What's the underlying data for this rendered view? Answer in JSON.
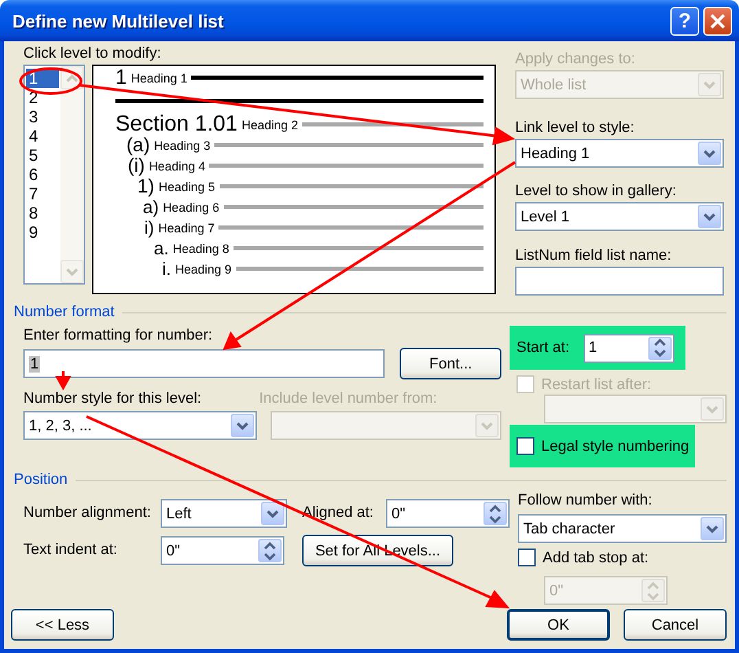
{
  "window": {
    "title": "Define new Multilevel list",
    "help_button": "?"
  },
  "level_list": {
    "label": "Click level to modify:",
    "items": [
      {
        "label": "1",
        "selected": true
      },
      {
        "label": "2",
        "selected": false
      },
      {
        "label": "3",
        "selected": false
      },
      {
        "label": "4",
        "selected": false
      },
      {
        "label": "5",
        "selected": false
      },
      {
        "label": "6",
        "selected": false
      },
      {
        "label": "7",
        "selected": false
      },
      {
        "label": "8",
        "selected": false
      },
      {
        "label": "9",
        "selected": false
      }
    ]
  },
  "preview": {
    "levels": [
      {
        "number": "1",
        "heading": "Heading 1",
        "selected": true
      },
      {
        "number": "Section 1.01",
        "heading": "Heading 2",
        "selected": false
      },
      {
        "number": "(a)",
        "heading": "Heading 3",
        "selected": false
      },
      {
        "number": "(i)",
        "heading": "Heading 4",
        "selected": false
      },
      {
        "number": "1)",
        "heading": "Heading 5",
        "selected": false
      },
      {
        "number": "a)",
        "heading": "Heading 6",
        "selected": false
      },
      {
        "number": "i)",
        "heading": "Heading 7",
        "selected": false
      },
      {
        "number": "a.",
        "heading": "Heading 8",
        "selected": false
      },
      {
        "number": "i.",
        "heading": "Heading 9",
        "selected": false
      }
    ]
  },
  "apply_changes": {
    "label": "Apply changes to:",
    "value": "Whole list",
    "disabled": true
  },
  "link_level": {
    "label": "Link level to style:",
    "value": "Heading 1"
  },
  "gallery_level": {
    "label": "Level to show in gallery:",
    "value": "Level 1"
  },
  "listnum_name": {
    "label": "ListNum field list name:"
  },
  "number_format": {
    "title": "Number format",
    "format_label": "Enter formatting for number:",
    "format_value": "1",
    "font_button": "Font...",
    "style_label": "Number style for this level:",
    "style_value": "1, 2, 3, ...",
    "include_label": "Include level number from:",
    "include_disabled": true,
    "start_label": "Start at:",
    "start_value": "1",
    "restart": {
      "label": "Restart list after:",
      "checked": false,
      "disabled": true
    },
    "legal": {
      "label": "Legal style numbering",
      "checked": false
    }
  },
  "position": {
    "title": "Position",
    "alignment_label": "Number alignment:",
    "alignment_value": "Left",
    "aligned_label": "Aligned at:",
    "aligned_value": "0\"",
    "indent_label": "Text indent at:",
    "indent_value": "0\"",
    "set_all_button": "Set for All Levels...",
    "follow_label": "Follow number with:",
    "follow_value": "Tab character",
    "add_tab_stop": {
      "label": "Add tab stop at:",
      "checked": false
    },
    "tab_stop_value": "0\"",
    "tab_stop_disabled": true
  },
  "buttons": {
    "less": "<< Less",
    "ok": "OK",
    "cancel": "Cancel"
  }
}
